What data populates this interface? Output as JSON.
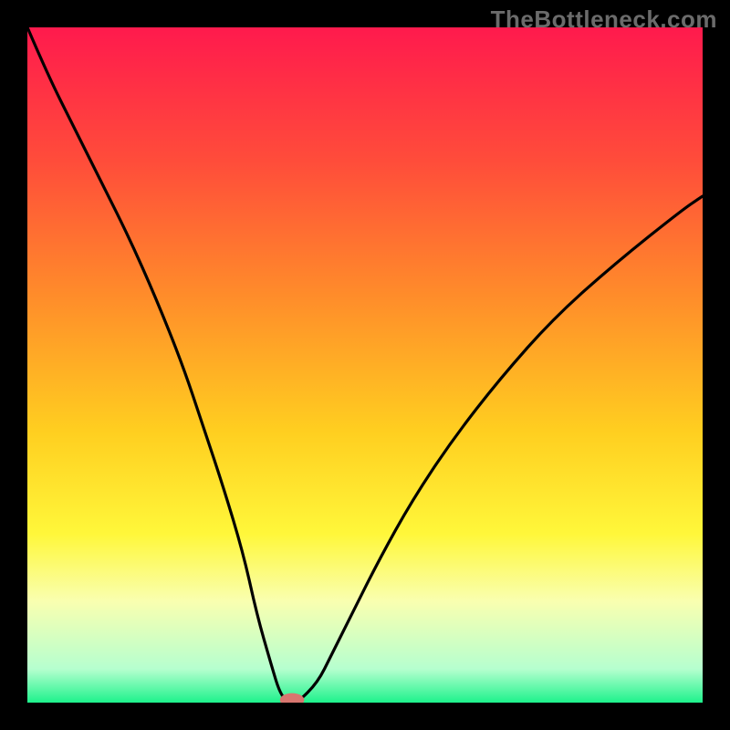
{
  "watermark": "TheBottleneck.com",
  "chart_data": {
    "type": "line",
    "title": "",
    "xlabel": "",
    "ylabel": "",
    "xlim": [
      0,
      100
    ],
    "ylim": [
      0,
      100
    ],
    "grid": false,
    "legend": false,
    "background_gradient_stops": [
      {
        "offset": 0.0,
        "color": "#ff1a4d"
      },
      {
        "offset": 0.2,
        "color": "#ff4d3a"
      },
      {
        "offset": 0.4,
        "color": "#ff8d2a"
      },
      {
        "offset": 0.6,
        "color": "#ffcf20"
      },
      {
        "offset": 0.75,
        "color": "#fff73a"
      },
      {
        "offset": 0.85,
        "color": "#f9ffb0"
      },
      {
        "offset": 0.95,
        "color": "#b6ffcf"
      },
      {
        "offset": 1.0,
        "color": "#1ef28c"
      }
    ],
    "series": [
      {
        "name": "bottleneck-curve",
        "x": [
          0,
          3,
          7,
          11,
          15,
          19,
          23,
          26,
          29,
          32,
          34,
          36,
          37.5,
          39,
          40,
          43,
          45,
          48,
          52,
          57,
          63,
          70,
          78,
          87,
          97,
          100
        ],
        "values": [
          100,
          93,
          85,
          77,
          69,
          60,
          50,
          41,
          32,
          22,
          13,
          6,
          1,
          0,
          0,
          3,
          7,
          13,
          21,
          30,
          39,
          48,
          57,
          65,
          73,
          75
        ]
      }
    ],
    "marker": {
      "x": 39.2,
      "y": 0.4,
      "rx": 1.8,
      "ry": 1.0,
      "color": "#d8766f"
    }
  }
}
